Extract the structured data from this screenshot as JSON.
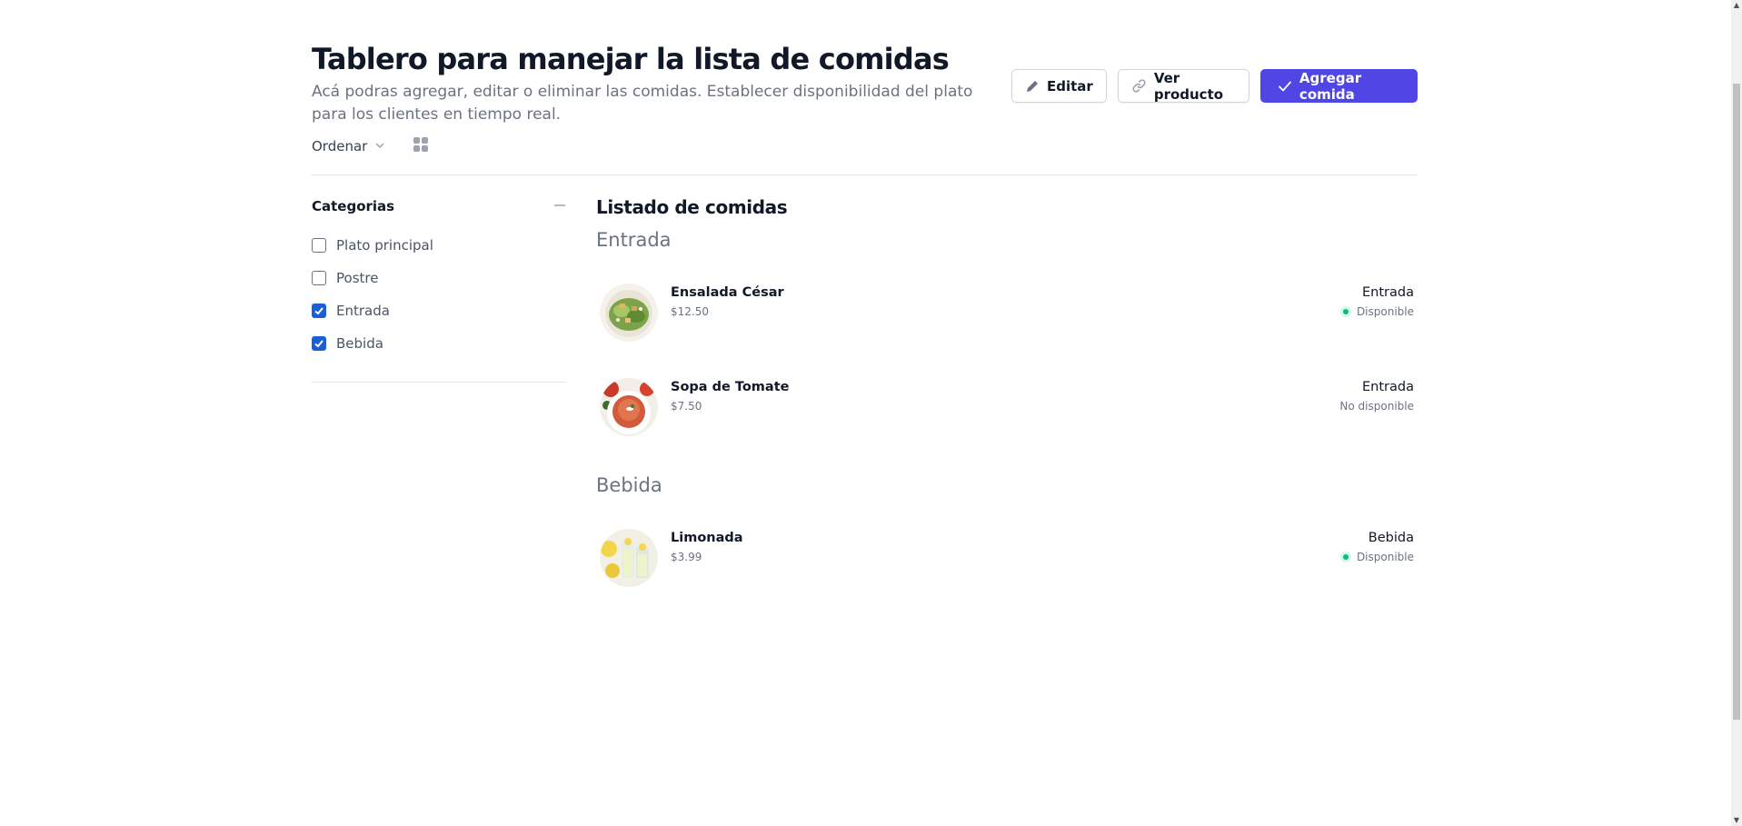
{
  "header": {
    "title": "Tablero para manejar la lista de comidas",
    "subtitle": "Acá podras agregar, editar o eliminar las comidas. Establecer disponibilidad del plato para los clientes en tiempo real.",
    "buttons": {
      "edit_label": "Editar",
      "view_label": "Ver producto",
      "add_label": "Agregar comida"
    },
    "accent_color": "#4f46e5"
  },
  "toolbar": {
    "sort_label": "Ordenar",
    "sort_icon": "chevron-down-icon",
    "view_icon": "grid-icon"
  },
  "sidebar": {
    "title": "Categorias",
    "collapse_icon": "minus-icon",
    "categories": [
      {
        "label": "Plato principal",
        "checked": false
      },
      {
        "label": "Postre",
        "checked": false
      },
      {
        "label": "Entrada",
        "checked": true
      },
      {
        "label": "Bebida",
        "checked": true
      }
    ]
  },
  "main": {
    "title": "Listado de comidas",
    "sections": [
      {
        "name": "Entrada",
        "items": [
          {
            "name": "Ensalada César",
            "price": "$12.50",
            "category": "Entrada",
            "status": "Disponible",
            "available": true,
            "image": "caesar-salad-image"
          },
          {
            "name": "Sopa de Tomate",
            "price": "$7.50",
            "category": "Entrada",
            "status": "No disponible",
            "available": false,
            "image": "tomato-soup-image"
          }
        ]
      },
      {
        "name": "Bebida",
        "items": [
          {
            "name": "Limonada",
            "price": "$3.99",
            "category": "Bebida",
            "status": "Disponible",
            "available": true,
            "image": "lemonade-image"
          }
        ]
      }
    ],
    "status_color": "#10b981"
  }
}
